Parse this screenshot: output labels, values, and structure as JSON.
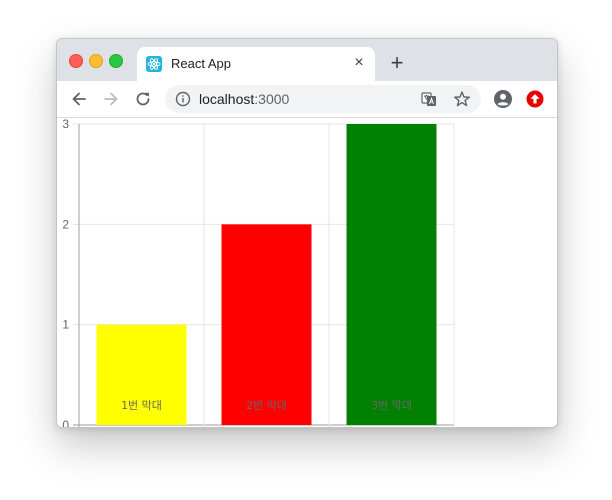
{
  "browser": {
    "tab_title": "React App",
    "tab_close": "×",
    "new_tab": "+",
    "url_host": "localhost",
    "url_port": ":3000"
  },
  "colors": {
    "tab_favicon": "#1fb6d8",
    "extension_badge": "#e60000"
  },
  "icons": {
    "back": "back-arrow-icon",
    "forward": "forward-arrow-icon",
    "reload": "reload-icon",
    "info": "info-icon",
    "translate": "translate-icon",
    "bookmark": "star-icon",
    "profile": "profile-icon",
    "extension": "extension-upload-icon",
    "favicon": "react-logo-icon"
  },
  "chart_data": {
    "type": "bar",
    "categories": [
      "1번 막대",
      "2번 막대",
      "3번 막대"
    ],
    "values": [
      1,
      2,
      3
    ],
    "colors": [
      "#ffff00",
      "#ff0000",
      "#008000"
    ],
    "ylim": [
      0,
      3
    ],
    "yticks": [
      "0",
      "1",
      "2",
      "3"
    ],
    "grid": true,
    "title": "",
    "xlabel": "",
    "ylabel": ""
  }
}
